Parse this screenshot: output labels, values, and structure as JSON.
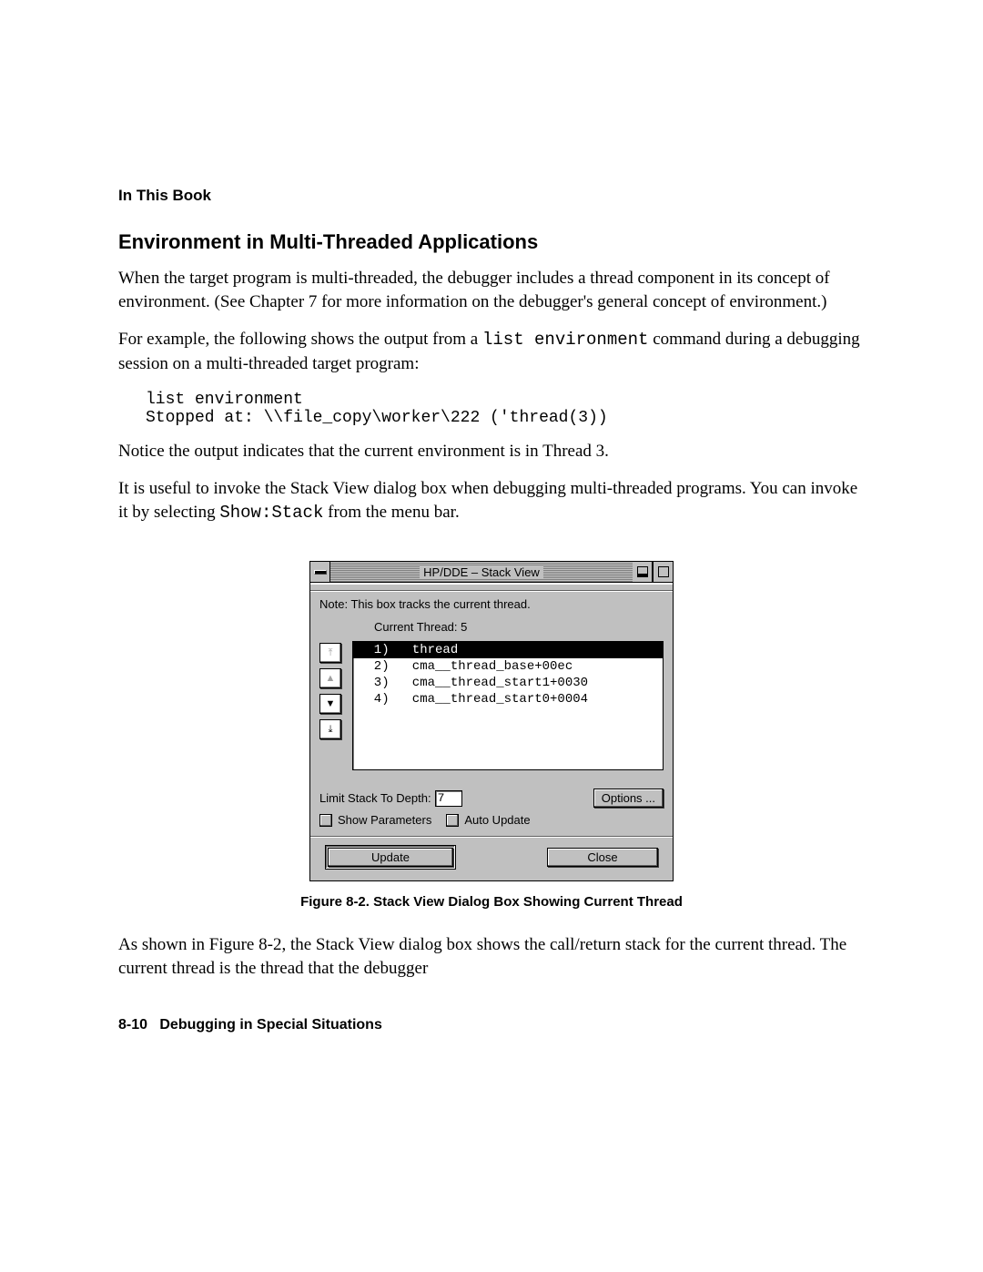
{
  "header": "In This Book",
  "section_title": "Environment in Multi-Threaded Applications",
  "para1_a": "When the target program is multi-threaded, the debugger includes a thread component in its concept of environment. (See Chapter 7 for more information on the debugger's general concept of environment.)",
  "para2_a": "For example, the following shows the output from a ",
  "para2_code": "list environment",
  "para2_b": " command during a debugging session on a multi-threaded target program:",
  "code_line1": "list environment",
  "code_line2": "Stopped at: \\\\file_copy\\worker\\222 ('thread(3))",
  "para3": "Notice the output indicates that the current environment is in Thread 3.",
  "para4_a": "It is useful to invoke the Stack View dialog box when debugging multi-threaded programs. You can invoke it by selecting ",
  "para4_code": "Show:Stack",
  "para4_b": " from the menu bar.",
  "dialog": {
    "title": "HP/DDE – Stack View",
    "note": "Note: This box tracks the current thread.",
    "current_thread_label": "Current Thread: ",
    "current_thread_value": "5",
    "stack": [
      {
        "n": "1)",
        "name": "thread",
        "selected": true
      },
      {
        "n": "2)",
        "name": "cma__thread_base+00ec",
        "selected": false
      },
      {
        "n": "3)",
        "name": "cma__thread_start1+0030",
        "selected": false
      },
      {
        "n": "4)",
        "name": "cma__thread_start0+0004",
        "selected": false
      }
    ],
    "limit_label": "Limit Stack To Depth:",
    "limit_value": "7",
    "options_label": "Options ...",
    "show_params_label": "Show Parameters",
    "auto_update_label": "Auto Update",
    "update_label": "Update",
    "close_label": "Close"
  },
  "caption": "Figure 8-2. Stack View Dialog Box Showing Current Thread",
  "para5": "As shown in Figure 8-2, the Stack View dialog box shows the call/return stack for the current thread. The current thread is the thread that the debugger",
  "footer_page": "8-10",
  "footer_title": "Debugging in Special Situations"
}
